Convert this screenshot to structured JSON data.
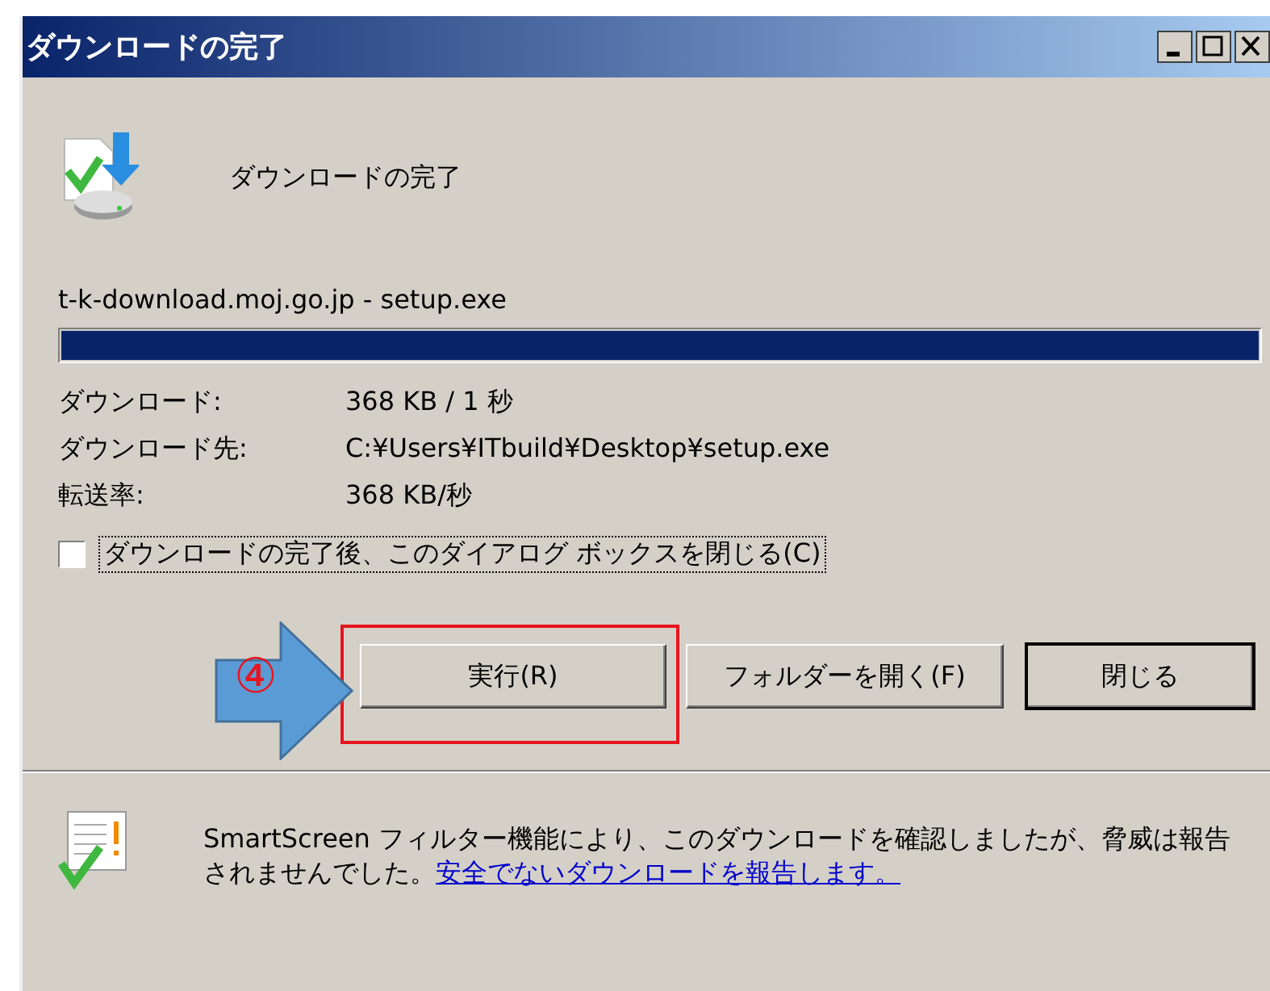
{
  "window": {
    "title": "ダウンロードの完了"
  },
  "header": {
    "text": "ダウンロードの完了"
  },
  "source": "t-k-download.moj.go.jp - setup.exe",
  "progress": {
    "level": 1
  },
  "details": [
    {
      "label": "ダウンロード:",
      "value": "368 KB / 1 秒"
    },
    {
      "label": "ダウンロード先:",
      "value": "C:¥Users¥ITbuild¥Desktop¥setup.exe"
    },
    {
      "label": "転送率:",
      "value": "368 KB/秒"
    }
  ],
  "close_option": {
    "label": "ダウンロードの完了後、このダイアログ ボックスを閉じる(C)",
    "checked": false
  },
  "buttons": [
    {
      "label": "実行(R)",
      "default": false,
      "highlighted": true
    },
    {
      "label": "フォルダーを開く(F)",
      "default": false,
      "highlighted": false
    },
    {
      "label": "閉じる",
      "default": true,
      "highlighted": false
    }
  ],
  "annotation": {
    "label": "④"
  },
  "footer": {
    "text": "SmartScreen フィルター機能により、このダウンロードを確認しましたが、脅威は報告されませんでした。",
    "link": "安全でないダウンロードを報告します。"
  }
}
